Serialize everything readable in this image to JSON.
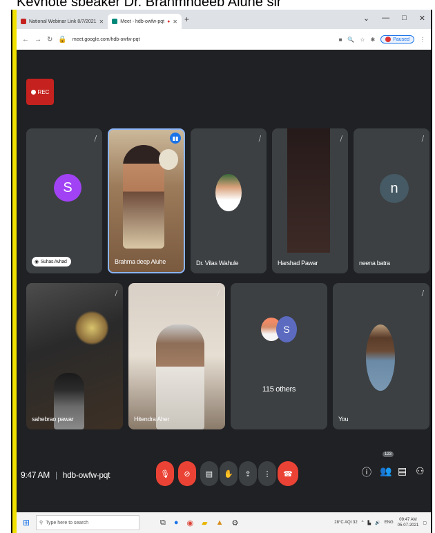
{
  "caption": "Keynote speaker Dr. Brahmhdeep Aluhe sir",
  "browser": {
    "tabs": [
      {
        "label": "National Webinar Link 8/7/2021",
        "color": "#c5221f"
      },
      {
        "label": "Meet - hdb-owfw-pqt",
        "color": "#00897b"
      }
    ],
    "new_tab": "+",
    "url": "meet.google.com/hdb-owfw-pqt",
    "paused_label": "Paused",
    "window_controls": [
      "—",
      "□",
      "✕"
    ]
  },
  "rec_label": "REC",
  "participants": [
    {
      "name": "Suhas Avhad",
      "avatar_letter": "S",
      "avatar_color": "#a142f4",
      "muted": true
    },
    {
      "name": "Brahma deep Aluhe",
      "speaking": true
    },
    {
      "name": "Dr. Vilas Wahule",
      "muted": true
    },
    {
      "name": "Harshad Pawar",
      "muted": true
    },
    {
      "name": "neena batra",
      "avatar_letter": "n",
      "avatar_color": "#455a64",
      "muted": true
    },
    {
      "name": "sahebrao pawar",
      "muted": true
    },
    {
      "name": "Hitendra Aher",
      "muted": true
    },
    {
      "name": "115 others",
      "avatar_letter": "S",
      "avatar_color": "#5c6bc0"
    },
    {
      "name": "You",
      "muted": true
    }
  ],
  "meeting": {
    "time": "9:47 AM",
    "separator": "|",
    "code": "hdb-owfw-pqt",
    "people_count": "123"
  },
  "taskbar": {
    "search_placeholder": "Type here to search",
    "weather": "28°C AQI 32",
    "lang": "ENG",
    "time": "09:47 AM",
    "date": "05-07-2021"
  }
}
